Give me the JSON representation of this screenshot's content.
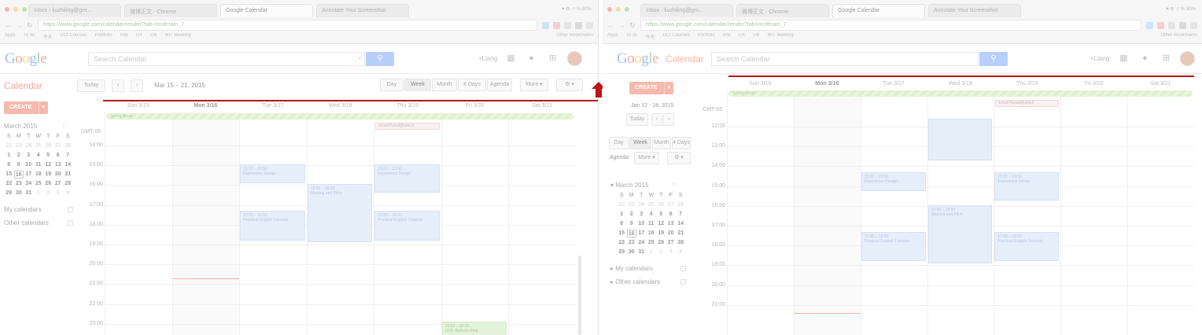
{
  "colors": {
    "accent_red": "#b01818",
    "google_blue": "#4285f4",
    "create_red": "#f6b9ae",
    "allday_green": "#dff1cf",
    "event_blue": "#e6eefa"
  },
  "browser": {
    "tabs": [
      "Inbox - liuzhiling@gm...",
      "微博正文 - Chrome",
      "Google Calendar",
      "Annotate Your Screenshot"
    ],
    "url": "https://www.google.com/calendar/render?tab=mc#main_7",
    "system_status": "♥ ⚙ ↗ % 80%",
    "bookmarks": [
      "Apps",
      "To do",
      "今天",
      "UCI Courses",
      "Portfolio",
      "IRB",
      "UX",
      "DB",
      "MIT Meeting",
      "scholarship"
    ],
    "other_bookmarks": "Other Bookmarks",
    "toolbar_icons": [
      "mail-icon",
      "gmail-icon",
      "drive-icon",
      "puzzle-icon",
      "menu-icon"
    ]
  },
  "left": {
    "search_placeholder": "Search Calendar",
    "user": "+Liang",
    "brand": "Calendar",
    "create": "CREATE",
    "today": "Today",
    "date_range": "Mar 15 – 21, 2015",
    "views": [
      "Day",
      "Week",
      "Month",
      "4 Days",
      "Agenda"
    ],
    "more": "More ▾",
    "settings": "⚙ ▾",
    "days": [
      "Sun 3/15",
      "Mon 3/16",
      "Tue 3/17",
      "Wed 3/18",
      "Thu 3/19",
      "Fri 3/20",
      "Sat 3/21"
    ],
    "timezone": "GMT-05",
    "hours": [
      "14:00",
      "15:00",
      "16:00",
      "17:00",
      "18:00",
      "19:00",
      "20:00",
      "21:00",
      "22:00",
      "23:00"
    ],
    "allday_event": "Spring Break",
    "chip_event": "Email Kunal@umich",
    "events": [
      {
        "time": "15:00 – 15:50",
        "title": "Experience Design"
      },
      {
        "time": "15:00 – 15:50",
        "title": "Experience Design"
      },
      {
        "time": "16:00 – 18:50",
        "title": "Meeting and Pitch"
      },
      {
        "time": "17:00 – 18:50",
        "title": "Practical English Tutorials"
      },
      {
        "time": "17:00 – 18:50",
        "title": "Practical English Tutorials"
      },
      {
        "time": "23:00 – 00:00",
        "title": "SVS: Refresh Blog"
      }
    ],
    "mini_cal_title": "March 2015",
    "my_calendars": "My calendars",
    "other_calendars": "Other calendars"
  },
  "right": {
    "search_placeholder": "Search Calendar",
    "user": "+Liang",
    "brand": "Calendar",
    "create": "CREATE",
    "date_range": "Jan 12 - 18, 2015",
    "today": "Today",
    "views": [
      "Day",
      "Week",
      "Month",
      "4 Days"
    ],
    "agenda": "Agenda",
    "more": "More ▾",
    "settings": "⚙ ▾",
    "days": [
      "Sun 3/15",
      "Mon 3/16",
      "Tue 3/17",
      "Wed 3/18",
      "Thu 3/19",
      "Fri 3/20",
      "Sat 3/21"
    ],
    "timezone": "GMT-05",
    "hours": [
      "12:00",
      "13:00",
      "14:00",
      "15:00",
      "16:00",
      "17:00",
      "18:00",
      "19:00",
      "20:00",
      "21:00"
    ],
    "allday_event": "Spring Break",
    "chip_event": "Email Kunal@umich",
    "events": [
      {
        "time": "",
        "title": ""
      },
      {
        "time": "15:00 – 15:50",
        "title": "Experience Design"
      },
      {
        "time": "15:00 – 15:50",
        "title": "Experience Design"
      },
      {
        "time": "16:00 – 18:50",
        "title": "Meeting and Pitch"
      },
      {
        "time": "17:00 – 18:50",
        "title": "Practical English Tutorials"
      },
      {
        "time": "17:00 – 18:50",
        "title": "Practical English Tutorials"
      }
    ],
    "mini_cal_title": "March 2015",
    "my_calendars": "My calendars",
    "other_calendars": "Other calendars"
  },
  "mini_calendar": {
    "weekdays": [
      "S",
      "M",
      "T",
      "W",
      "T",
      "F",
      "S"
    ],
    "weeks": [
      [
        "22",
        "23",
        "24",
        "25",
        "26",
        "27",
        "28"
      ],
      [
        "1",
        "2",
        "3",
        "4",
        "5",
        "6",
        "7"
      ],
      [
        "8",
        "9",
        "10",
        "11",
        "12",
        "13",
        "14"
      ],
      [
        "15",
        "16",
        "17",
        "18",
        "19",
        "20",
        "21"
      ],
      [
        "22",
        "23",
        "24",
        "25",
        "26",
        "27",
        "28"
      ],
      [
        "29",
        "30",
        "31",
        "1",
        "2",
        "3",
        "4"
      ]
    ]
  }
}
